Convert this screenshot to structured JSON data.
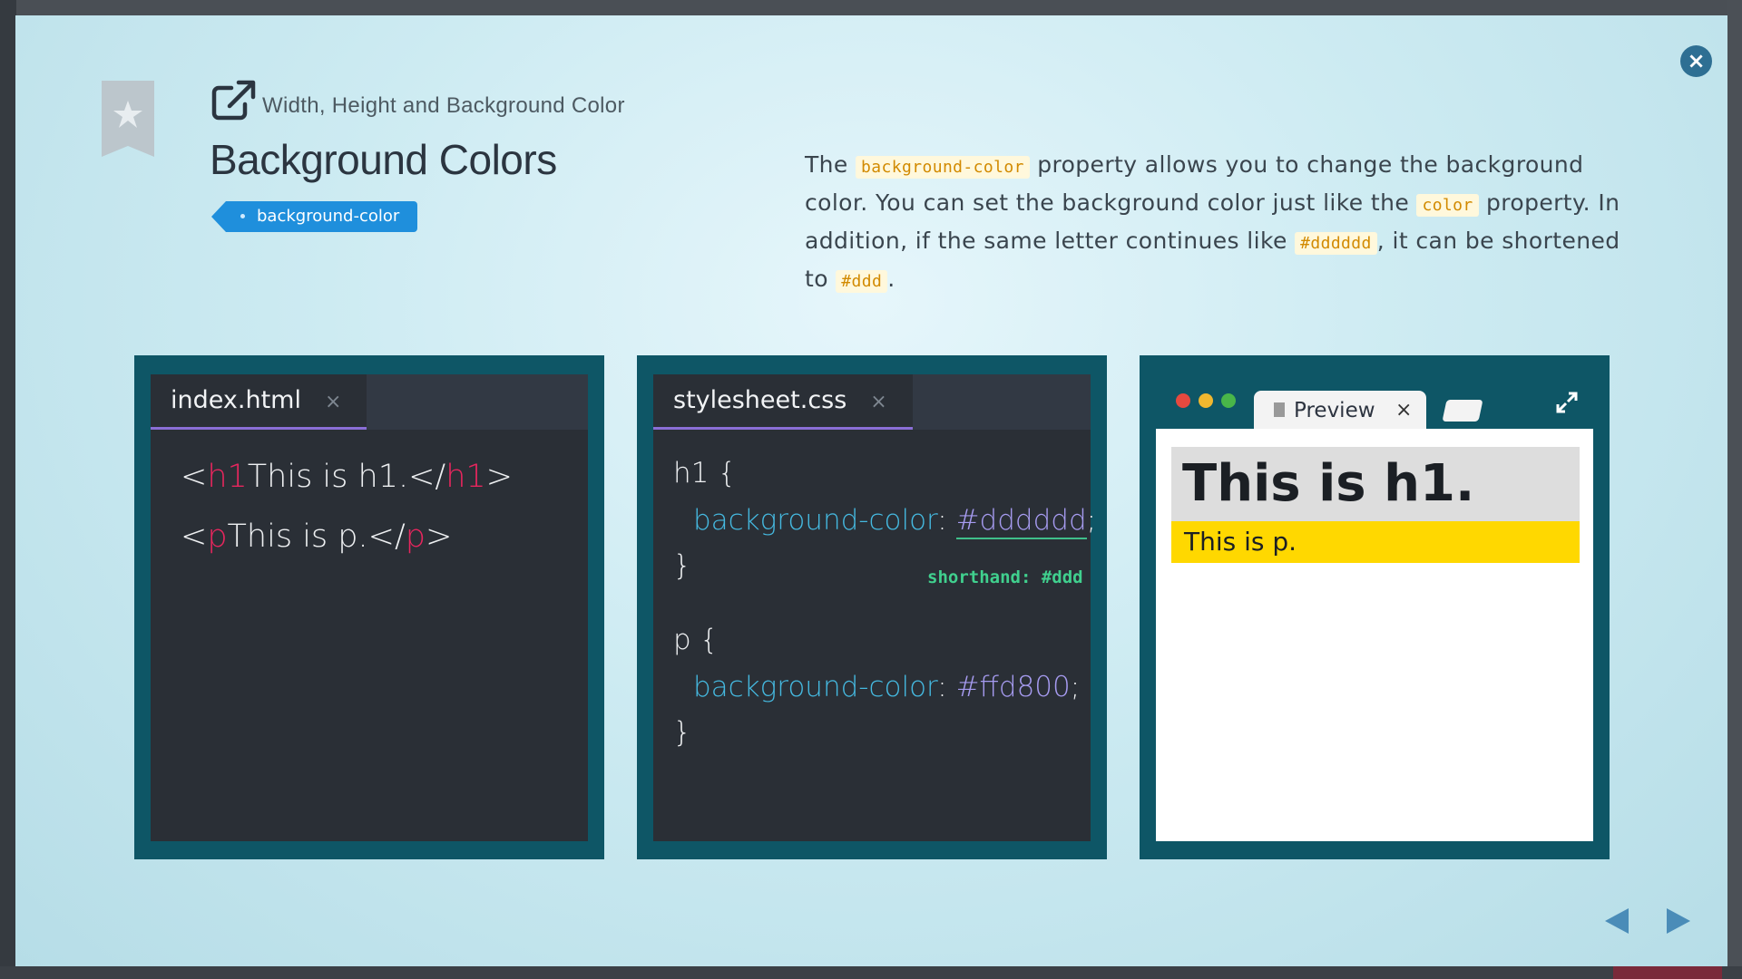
{
  "lesson": {
    "breadcrumb": "Width, Height and Background Color",
    "title": "Background Colors",
    "tag": "background-color"
  },
  "description": {
    "t1": "The ",
    "c1": "background-color",
    "t2": " property allows you to change the background color. You can set the background color just like the ",
    "c2": "color",
    "t3": " property. In addition, if the same letter continues like ",
    "c3": "#dddddd",
    "t4": ", it can be shortened to ",
    "c4": "#ddd",
    "t5": "."
  },
  "html_editor": {
    "tab": "index.html",
    "close": "×",
    "line1": {
      "open_lt": "<",
      "open_tag": "h1",
      "text": "This is h1.",
      "close_lt": "</",
      "close_tag": "h1",
      "gt": ">"
    },
    "line2": {
      "open_lt": "<",
      "open_tag": "p",
      "text": "This is p.",
      "close_lt": "</",
      "close_tag": "p",
      "gt": ">"
    }
  },
  "css_editor": {
    "tab": "stylesheet.css",
    "close": "×",
    "rule1": {
      "selector": "h1 {",
      "prop": "background-color",
      "colon": ": ",
      "value": "#dddddd",
      "semi": ";",
      "close": "}"
    },
    "rule2": {
      "selector": "p {",
      "prop": "background-color",
      "colon": ": ",
      "value": "#ffd800",
      "semi": ";",
      "close": "}"
    },
    "hint": "shorthand: #ddd"
  },
  "preview": {
    "tab": "Preview",
    "close": "×",
    "h1_text": "This is h1.",
    "p_text": "This is p.",
    "h1_bg": "#dddddd",
    "p_bg": "#ffd800"
  },
  "modal_close": "×",
  "colors": {
    "panel": "#0e5666",
    "editor": "#2a2f36",
    "tag_color": "#e8265e",
    "prop_color": "#45b9e0",
    "accent": "#1f8fdc"
  }
}
